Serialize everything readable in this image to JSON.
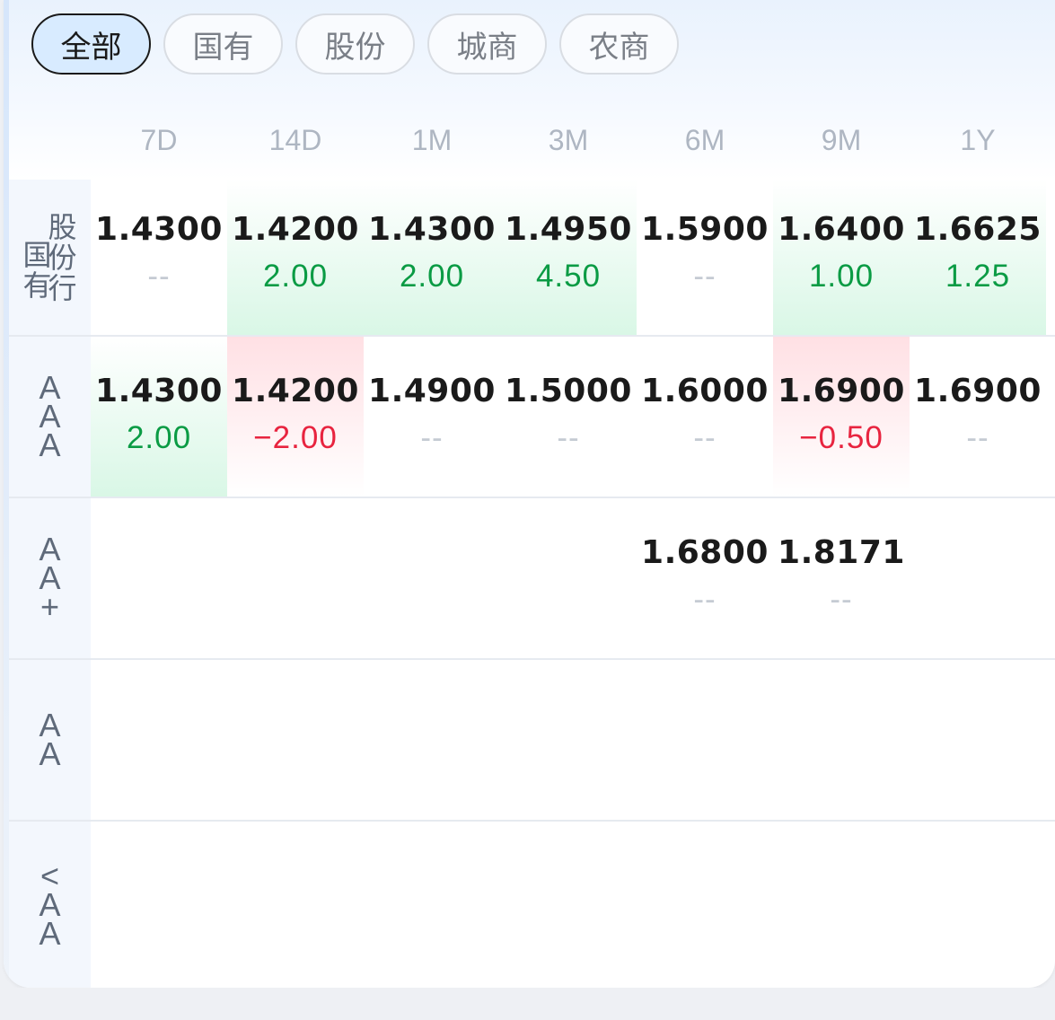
{
  "tabs": [
    {
      "label": "全部",
      "active": true
    },
    {
      "label": "国有",
      "active": false
    },
    {
      "label": "股份",
      "active": false
    },
    {
      "label": "城商",
      "active": false
    },
    {
      "label": "农商",
      "active": false
    }
  ],
  "columns": [
    "7D",
    "14D",
    "1M",
    "3M",
    "6M",
    "9M",
    "1Y"
  ],
  "rows": [
    {
      "label_left": [
        "国",
        "有"
      ],
      "label_right": [
        "股",
        "份",
        "行"
      ],
      "cells": [
        {
          "rate": "1.4300",
          "change": "--",
          "trend": "flat"
        },
        {
          "rate": "1.4200",
          "change": "2.00",
          "trend": "up"
        },
        {
          "rate": "1.4300",
          "change": "2.00",
          "trend": "up"
        },
        {
          "rate": "1.4950",
          "change": "4.50",
          "trend": "up"
        },
        {
          "rate": "1.5900",
          "change": "--",
          "trend": "flat"
        },
        {
          "rate": "1.6400",
          "change": "1.00",
          "trend": "up"
        },
        {
          "rate": "1.6625",
          "change": "1.25",
          "trend": "up"
        }
      ]
    },
    {
      "label": [
        "A",
        "A",
        "A"
      ],
      "cells": [
        {
          "rate": "1.4300",
          "change": "2.00",
          "trend": "up"
        },
        {
          "rate": "1.4200",
          "change": "−2.00",
          "trend": "down"
        },
        {
          "rate": "1.4900",
          "change": "--",
          "trend": "flat"
        },
        {
          "rate": "1.5000",
          "change": "--",
          "trend": "flat"
        },
        {
          "rate": "1.6000",
          "change": "--",
          "trend": "flat"
        },
        {
          "rate": "1.6900",
          "change": "−0.50",
          "trend": "down"
        },
        {
          "rate": "1.6900",
          "change": "--",
          "trend": "flat"
        }
      ]
    },
    {
      "label": [
        "A",
        "A",
        "+"
      ],
      "cells": [
        null,
        null,
        null,
        null,
        {
          "rate": "1.6800",
          "change": "--",
          "trend": "flat"
        },
        {
          "rate": "1.8171",
          "change": "--",
          "trend": "flat"
        },
        null
      ]
    },
    {
      "label": [
        "A",
        "A"
      ],
      "cells": [
        null,
        null,
        null,
        null,
        null,
        null,
        null
      ]
    },
    {
      "label": [
        "<",
        "A",
        "A"
      ],
      "cells": [
        null,
        null,
        null,
        null,
        null,
        null,
        null
      ]
    }
  ],
  "colors": {
    "up": "#0a9b44",
    "down": "#e8243f",
    "flat": "#c5cbd3",
    "active_tab_bg": "#d8ebff"
  }
}
